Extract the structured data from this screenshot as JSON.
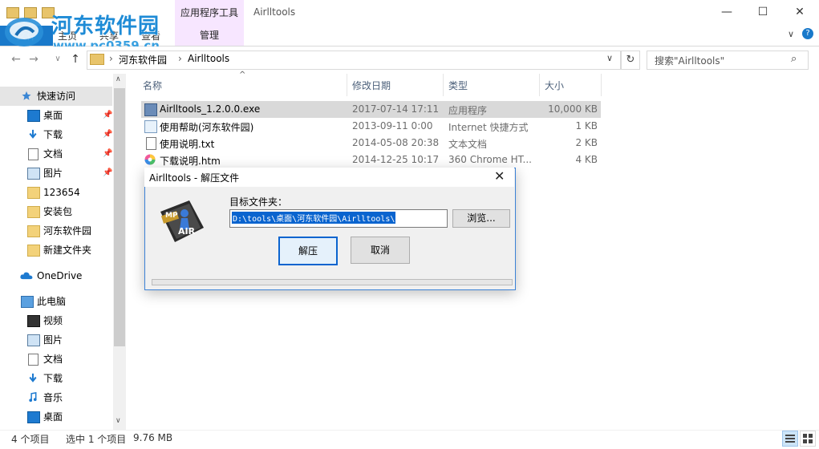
{
  "window": {
    "title": "Airlltools",
    "context_tab_group": "应用程序工具",
    "minimize": "—",
    "maximize": "☐",
    "close": "✕"
  },
  "ribbon": {
    "tabs": [
      "文件",
      "主页",
      "共享",
      "查看"
    ],
    "manage_tab": "管理",
    "help": "?",
    "collapse": "∨"
  },
  "watermark": {
    "site_name": "河东软件园",
    "url": "www.pc0359.cn"
  },
  "address": {
    "back": "←",
    "forward": "→",
    "recent": "∨",
    "up": "↑",
    "crumbs": [
      "河东软件园",
      "Airlltools"
    ],
    "separator": "›",
    "dropdown": "∨",
    "refresh": "↻"
  },
  "search": {
    "placeholder": "搜索\"Airlltools\"",
    "icon": "⌕"
  },
  "nav_pane": {
    "quick_access": "快速访问",
    "items": [
      {
        "label": "桌面",
        "icon": "desktop-icon",
        "pinned": true
      },
      {
        "label": "下载",
        "icon": "download-icon",
        "pinned": true
      },
      {
        "label": "文档",
        "icon": "document-icon",
        "pinned": true
      },
      {
        "label": "图片",
        "icon": "picture-icon",
        "pinned": true
      },
      {
        "label": "123654",
        "icon": "folder-icon",
        "pinned": false
      },
      {
        "label": "安装包",
        "icon": "folder-icon",
        "pinned": false
      },
      {
        "label": "河东软件园",
        "icon": "folder-icon",
        "pinned": false
      },
      {
        "label": "新建文件夹",
        "icon": "folder-icon",
        "pinned": false
      }
    ],
    "onedrive": "OneDrive",
    "this_pc": "此电脑",
    "pc_items": [
      {
        "label": "视频",
        "icon": "video-icon"
      },
      {
        "label": "图片",
        "icon": "picture-icon"
      },
      {
        "label": "文档",
        "icon": "document-icon"
      },
      {
        "label": "下载",
        "icon": "download-icon"
      },
      {
        "label": "音乐",
        "icon": "music-icon"
      },
      {
        "label": "桌面",
        "icon": "desktop-icon"
      }
    ],
    "pin_glyph": "📌",
    "scroll_up": "∧",
    "scroll_down": "∨"
  },
  "file_list": {
    "sort_arrow": "^",
    "columns": [
      "名称",
      "修改日期",
      "类型",
      "大小"
    ],
    "rows": [
      {
        "name": "Airlltools_1.2.0.0.exe",
        "date": "2017-07-14 17:11",
        "type": "应用程序",
        "size": "10,000 KB",
        "selected": true
      },
      {
        "name": "使用帮助(河东软件园)",
        "date": "2013-09-11 0:00",
        "type": "Internet 快捷方式",
        "size": "1 KB",
        "selected": false
      },
      {
        "name": "使用说明.txt",
        "date": "2014-05-08 20:38",
        "type": "文本文档",
        "size": "2 KB",
        "selected": false
      },
      {
        "name": "下载说明.htm",
        "date": "2014-12-25 10:17",
        "type": "360 Chrome HT...",
        "size": "4 KB",
        "selected": false
      }
    ]
  },
  "dialog": {
    "title": "Airlltools - 解压文件",
    "close": "✕",
    "target_label": "目标文件夹：",
    "target_path": "D:\\tools\\桌面\\河东软件园\\Airlltools\\",
    "browse": "浏览...",
    "extract": "解压",
    "cancel": "取消",
    "progress": 0,
    "logo_text": "AIR",
    "logo_badge": "MP"
  },
  "status": {
    "item_count": "4 个项目",
    "selection": "选中 1 个项目",
    "size": "9.76 MB"
  },
  "colors": {
    "accent": "#1979ca",
    "selection": "#0a64cf",
    "context_tab": "#f7e6ff"
  }
}
